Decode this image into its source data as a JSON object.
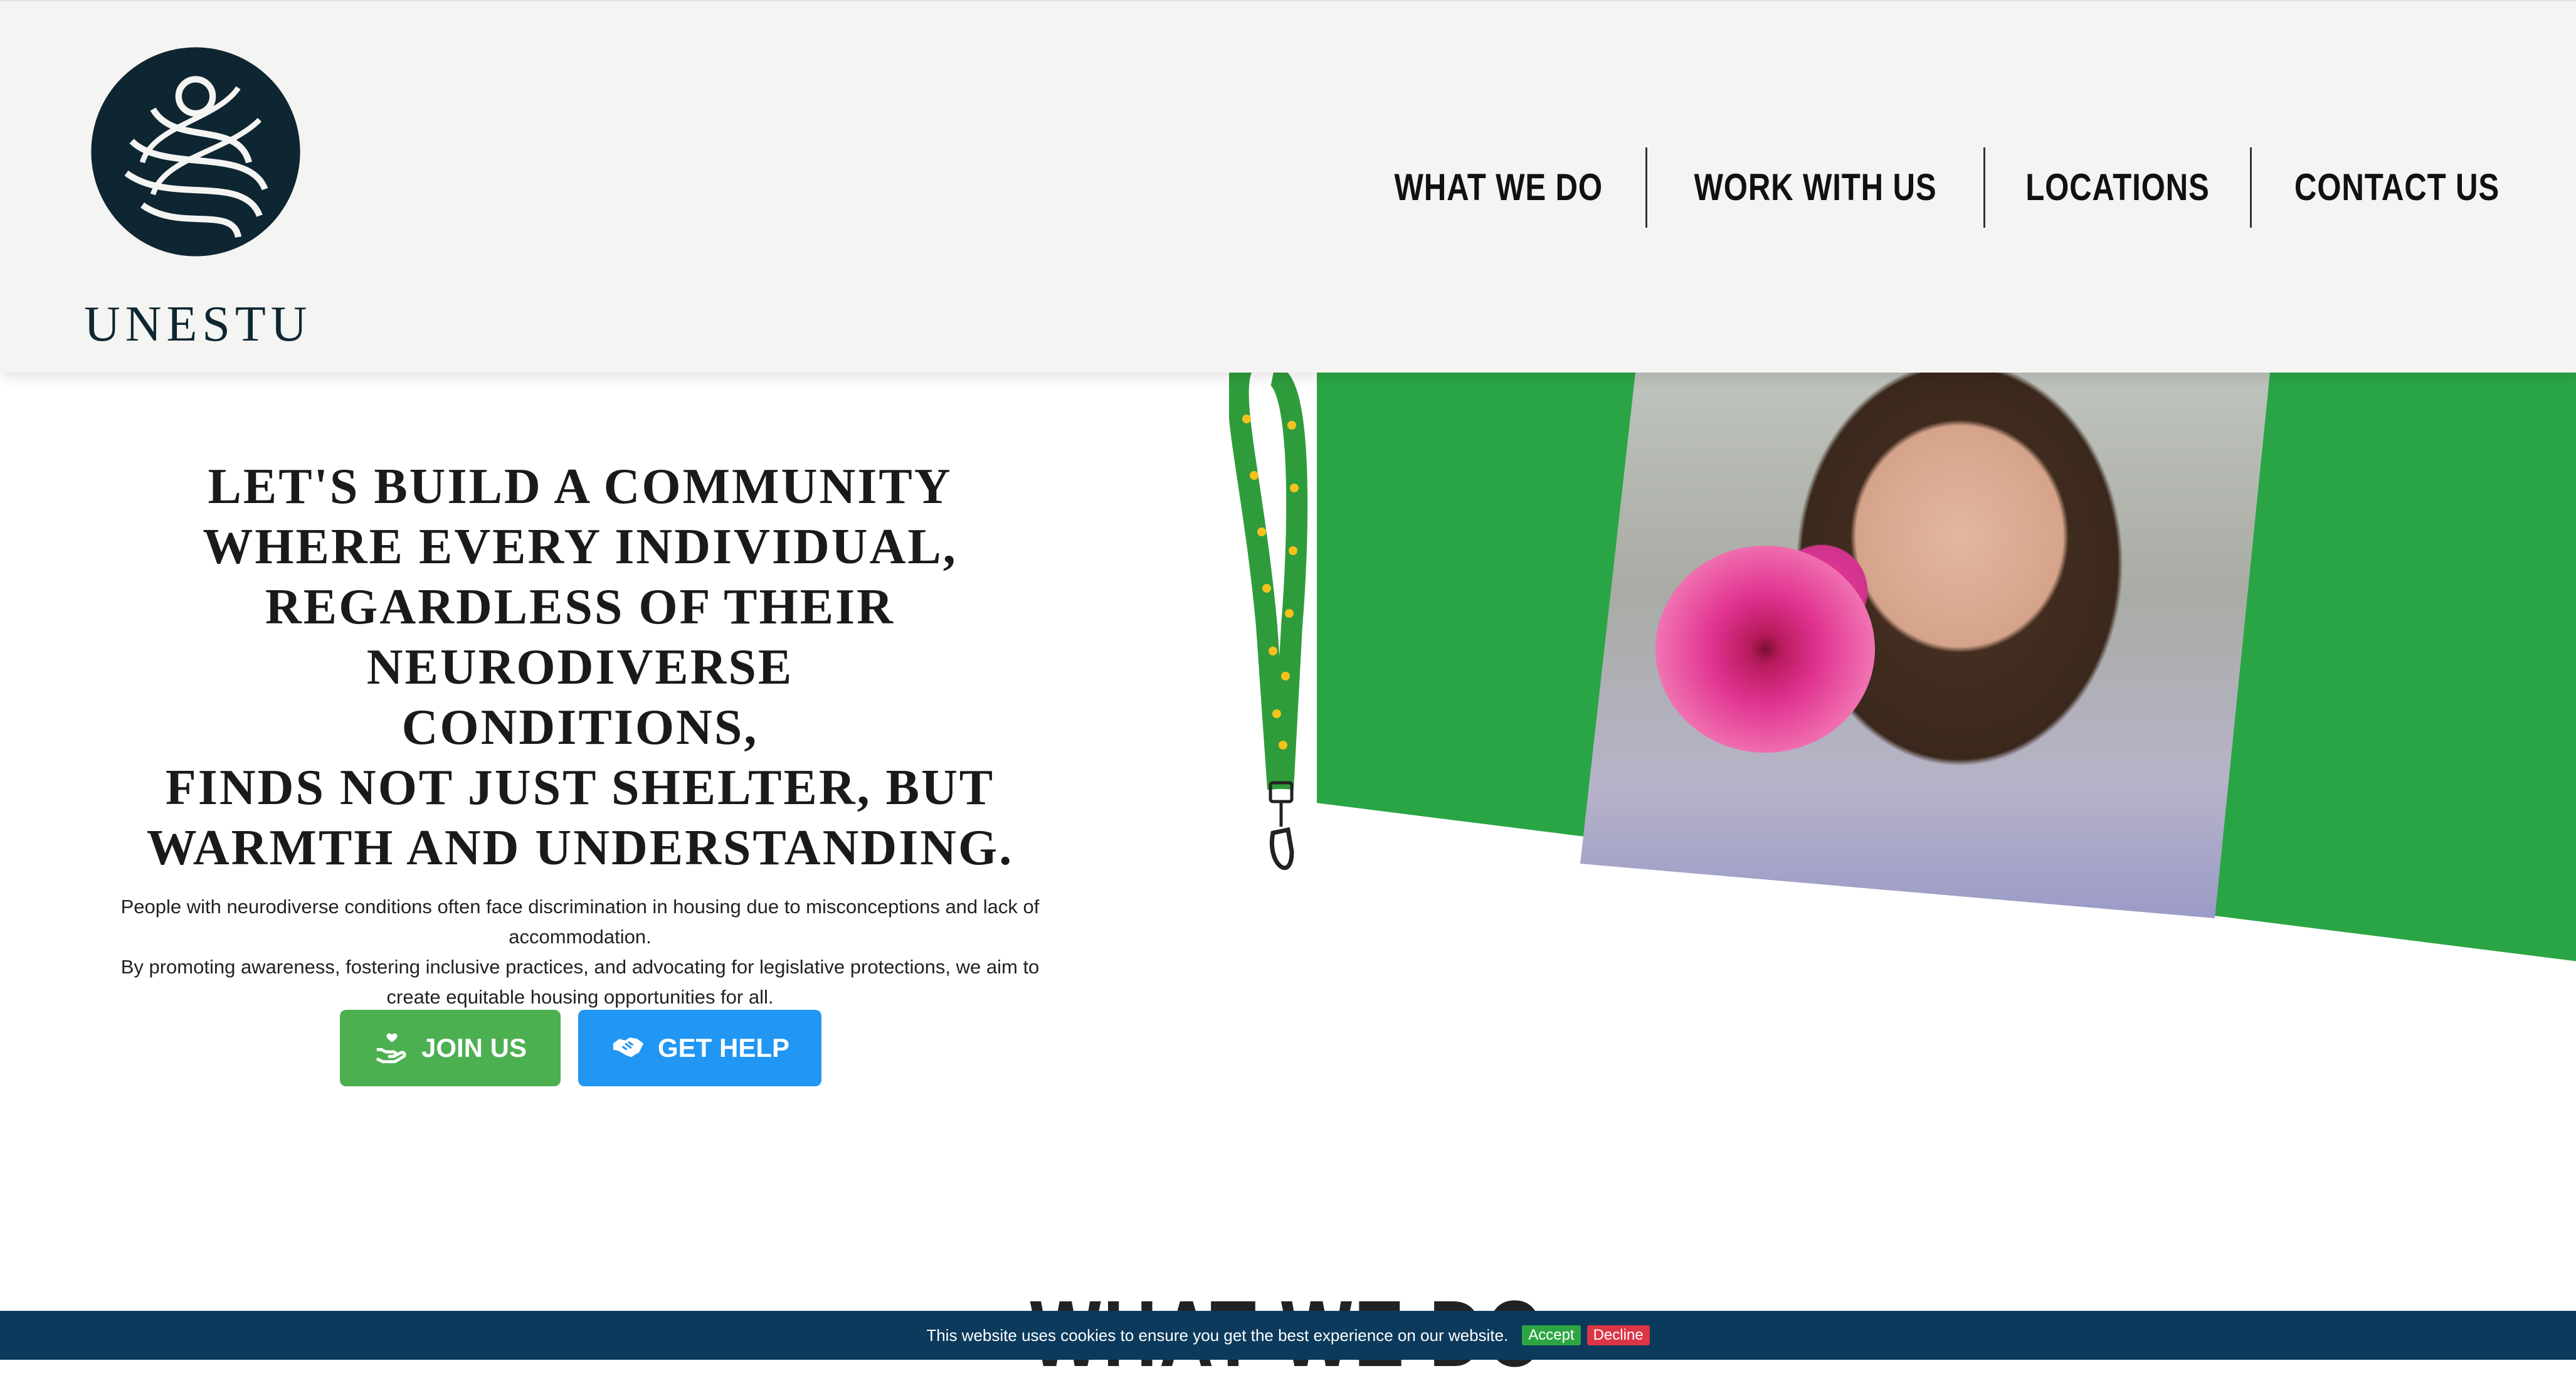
{
  "brand": {
    "name": "UNESTU",
    "logo_icon": "swirl-logo-icon",
    "color": "#0e2631"
  },
  "nav": {
    "items": [
      "WHAT WE DO",
      "WORK WITH US",
      "LOCATIONS",
      "CONTACT US"
    ]
  },
  "hero": {
    "heading_lines": [
      "LET'S BUILD A COMMUNITY",
      "WHERE EVERY INDIVIDUAL,",
      "REGARDLESS OF THEIR NEURODIVERSE",
      "CONDITIONS,",
      "FINDS NOT JUST SHELTER, BUT",
      "WARMTH AND UNDERSTANDING."
    ],
    "body_lines": [
      "People with neurodiverse conditions often face discrimination in housing due to misconceptions and lack of",
      "accommodation.",
      "By promoting awareness, fostering inclusive practices, and advocating for legislative protections, we aim to",
      "create equitable housing opportunities for all."
    ],
    "join_button": {
      "label": "JOIN US",
      "icon": "hand-heart-icon",
      "color": "#4caf50"
    },
    "help_button": {
      "label": "GET HELP",
      "icon": "handshake-icon",
      "color": "#2196f3"
    }
  },
  "colors": {
    "card_green": "#2aa545",
    "header_bg": "#f4f4f2"
  },
  "section": {
    "title": "WHAT WE DO"
  },
  "cookie": {
    "text": "This website uses cookies to ensure you get the best experience on our website.",
    "accept": "Accept",
    "decline": "Decline"
  }
}
